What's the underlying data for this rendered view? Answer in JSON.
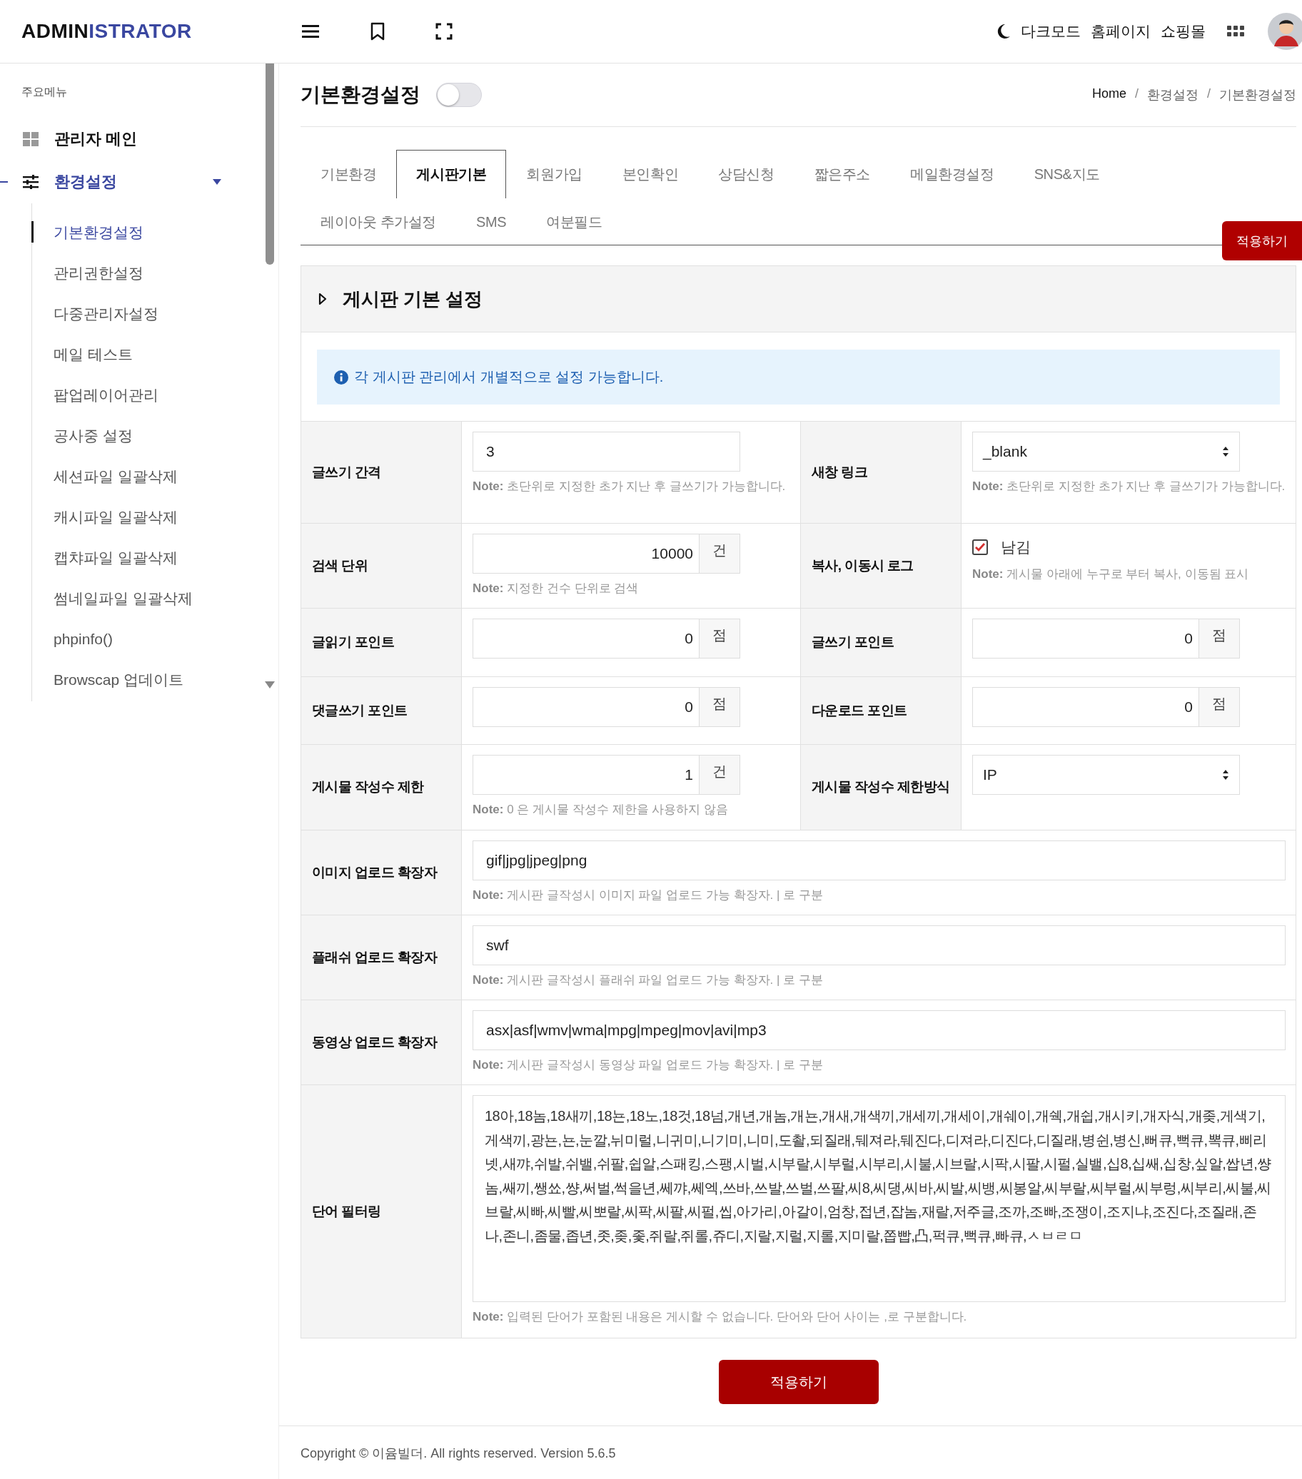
{
  "header": {
    "logo_bold": "ADMIN",
    "logo_accent": "ISTRATOR",
    "links": [
      "다크모드",
      "홈페이지",
      "쇼핑몰"
    ]
  },
  "sidebar": {
    "section_label": "주요메뉴",
    "items": [
      {
        "label": "관리자 메인",
        "selected": false
      },
      {
        "label": "환경설정",
        "selected": true,
        "expanded": true,
        "children": [
          {
            "label": "기본환경설정",
            "selected": true
          },
          {
            "label": "관리권한설정",
            "selected": false
          },
          {
            "label": "다중관리자설정",
            "selected": false
          },
          {
            "label": "메일 테스트",
            "selected": false
          },
          {
            "label": "팝업레이어관리",
            "selected": false
          },
          {
            "label": "공사중 설정",
            "selected": false
          },
          {
            "label": "세션파일 일괄삭제",
            "selected": false
          },
          {
            "label": "캐시파일 일괄삭제",
            "selected": false
          },
          {
            "label": "캡챠파일 일괄삭제",
            "selected": false
          },
          {
            "label": "썸네일파일 일괄삭제",
            "selected": false
          },
          {
            "label": "phpinfo()",
            "selected": false
          },
          {
            "label": "Browscap 업데이트",
            "selected": false
          }
        ]
      }
    ]
  },
  "page": {
    "title": "기본환경설정",
    "toggle_on": false,
    "breadcrumb": [
      "Home",
      "환경설정",
      "기본환경설정"
    ],
    "breadcrumb_separator": "/"
  },
  "tab_rows": [
    [
      {
        "label": "기본환경",
        "selected": false
      },
      {
        "label": "게시판기본",
        "selected": true
      },
      {
        "label": "회원가입",
        "selected": false
      },
      {
        "label": "본인확인",
        "selected": false
      },
      {
        "label": "상담신청",
        "selected": false
      },
      {
        "label": "짧은주소",
        "selected": false
      },
      {
        "label": "메일환경설정",
        "selected": false
      },
      {
        "label": "SNS&지도",
        "selected": false
      }
    ],
    [
      {
        "label": "레이아웃 추가설정",
        "selected": false
      },
      {
        "label": "SMS",
        "selected": false
      },
      {
        "label": "여분필드",
        "selected": false
      }
    ]
  ],
  "top_apply_button": "적용하기",
  "section": {
    "title": "게시판 기본 설정",
    "info": "각 게시판 관리에서 개별적으로 설정 가능합니다.",
    "rows": [
      {
        "fields": [
          {
            "label": "글쓰기 간격",
            "kind": "text",
            "value": "3",
            "note": "**Note:** 초단위로 지정한 초가 지난 후 글쓰기가 가능합니다."
          },
          {
            "label": "새창 링크",
            "kind": "select",
            "value": "_blank",
            "note": "**Note:** 초단위로 지정한 초가 지난 후 글쓰기가 가능합니다."
          }
        ]
      },
      {
        "fields": [
          {
            "label": "검색 단위",
            "kind": "number",
            "value": "10000",
            "unit": "건",
            "note": "**Note:** 지정한 건수 단위로 검색"
          },
          {
            "label": "복사, 이동시 로그",
            "kind": "checkbox",
            "option": "남김",
            "checked": true,
            "note": "**Note:** 게시물 아래에 누구로 부터 복사, 이동됨 표시"
          }
        ]
      },
      {
        "fields": [
          {
            "label": "글읽기 포인트",
            "kind": "number",
            "value": "0",
            "unit": "점"
          },
          {
            "label": "글쓰기 포인트",
            "kind": "number",
            "value": "0",
            "unit": "점"
          }
        ]
      },
      {
        "fields": [
          {
            "label": "댓글쓰기 포인트",
            "kind": "number",
            "value": "0",
            "unit": "점"
          },
          {
            "label": "다운로드 포인트",
            "kind": "number",
            "value": "0",
            "unit": "점"
          }
        ]
      },
      {
        "fields": [
          {
            "label": "게시물 작성수 제한",
            "kind": "number",
            "value": "1",
            "unit": "건",
            "note": "**Note:** 0 은 게시물 작성수 제한을 사용하지 않음"
          },
          {
            "label": "게시물 작성수 제한방식",
            "kind": "select",
            "value": "IP"
          }
        ]
      },
      {
        "fields": [
          {
            "label": "이미지 업로드 확장자",
            "kind": "text",
            "value": "gif|jpg|jpeg|png",
            "note": "**Note:** 게시판 글작성시 이미지 파일 업로드 가능 확장자. | 로 구분"
          }
        ]
      },
      {
        "fields": [
          {
            "label": "플래쉬 업로드 확장자",
            "kind": "text",
            "value": "swf",
            "note": "**Note:** 게시판 글작성시 플래쉬 파일 업로드 가능 확장자. | 로 구분"
          }
        ]
      },
      {
        "fields": [
          {
            "label": "동영상 업로드 확장자",
            "kind": "text",
            "value": "asx|asf|wmv|wma|mpg|mpeg|mov|avi|mp3",
            "note": "**Note:** 게시판 글작성시 동영상 파일 업로드 가능 확장자. | 로 구분"
          }
        ]
      },
      {
        "fields": [
          {
            "label": "단어 필터링",
            "kind": "textarea",
            "value": "18아,18놈,18새끼,18뇬,18노,18것,18넘,개년,개놈,개뇬,개새,개색끼,개세끼,개세이,개쉐이,개쉑,개쉽,개시키,개자식,개좆,게색기,게색끼,광뇬,뇬,눈깔,뉘미럴,니귀미,니기미,니미,도촬,되질래,뒈져라,뒈진다,디져라,디진다,디질래,병쉰,병신,뻐큐,뻑큐,뽁큐,삐리넷,새꺄,쉬발,쉬밸,쉬팔,쉽알,스패킹,스팽,시벌,시부랄,시부럴,시부리,시불,시브랄,시팍,시팔,시펄,실밸,십8,십쌔,십창,싶알,쌉년,썅놈,쌔끼,쌩쑈,썅,써벌,썩을년,쎄꺄,쎄엑,쓰바,쓰발,쓰벌,쓰팔,씨8,씨댕,씨바,씨발,씨뱅,씨봉알,씨부랄,씨부럴,씨부렁,씨부리,씨불,씨브랄,씨빠,씨빨,씨뽀랄,씨팍,씨팔,씨펄,씹,아가리,아갈이,엄창,접년,잡놈,재랄,저주글,조까,조빠,조쟁이,조지냐,조진다,조질래,존나,존니,좀물,좁년,좃,좆,좇,쥐랄,쥐롤,쥬디,지랄,지럴,지롤,지미랄,쫍빱,凸,퍽큐,뻑큐,빠큐,ㅅㅂㄹㅁ",
            "note": "**Note:** 입력된 단어가 포함된 내용은 게시할 수 없습니다. 단어와 단어 사이는 ,로 구분합니다."
          }
        ]
      }
    ]
  },
  "bottom_apply_button": "적용하기",
  "footer": "Copyright © 이윰빌더. All rights reserved. Version 5.6.5"
}
